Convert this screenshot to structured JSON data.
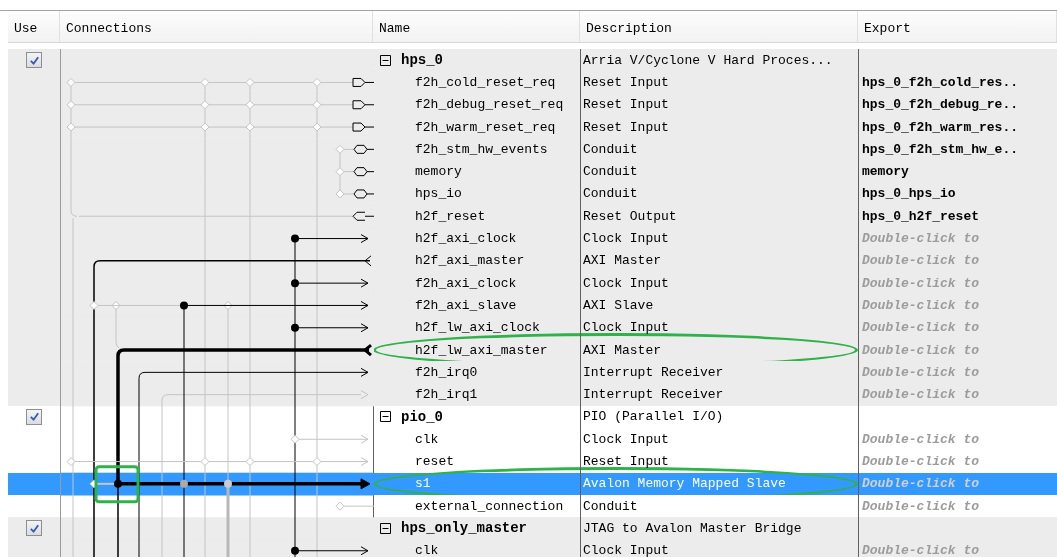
{
  "columns": [
    "Use",
    "Connections",
    "Name",
    "Description",
    "Export"
  ],
  "modules": [
    {
      "name": "hps_0",
      "description": "Arria V/Cyclone V Hard Proces...",
      "use": true,
      "expanded": true,
      "interfaces": [
        {
          "name": "f2h_cold_reset_req",
          "description": "Reset Input",
          "export": {
            "kind": "name",
            "text": "hps_0_f2h_cold_res.."
          },
          "selected": false,
          "circled": false
        },
        {
          "name": "f2h_debug_reset_req",
          "description": "Reset Input",
          "export": {
            "kind": "name",
            "text": "hps_0_f2h_debug_re.."
          },
          "selected": false,
          "circled": false
        },
        {
          "name": "f2h_warm_reset_req",
          "description": "Reset Input",
          "export": {
            "kind": "name",
            "text": "hps_0_f2h_warm_res.."
          },
          "selected": false,
          "circled": false
        },
        {
          "name": "f2h_stm_hw_events",
          "description": "Conduit",
          "export": {
            "kind": "name",
            "text": "hps_0_f2h_stm_hw_e.."
          },
          "selected": false,
          "circled": false
        },
        {
          "name": "memory",
          "description": "Conduit",
          "export": {
            "kind": "name",
            "text": "memory"
          },
          "selected": false,
          "circled": false
        },
        {
          "name": "hps_io",
          "description": "Conduit",
          "export": {
            "kind": "name",
            "text": "hps_0_hps_io"
          },
          "selected": false,
          "circled": false
        },
        {
          "name": "h2f_reset",
          "description": "Reset Output",
          "export": {
            "kind": "name",
            "text": "hps_0_h2f_reset"
          },
          "selected": false,
          "circled": false
        },
        {
          "name": "h2f_axi_clock",
          "description": "Clock Input",
          "export": {
            "kind": "hint",
            "text": "Double-click to"
          },
          "selected": false,
          "circled": false
        },
        {
          "name": "h2f_axi_master",
          "description": "AXI Master",
          "export": {
            "kind": "hint",
            "text": "Double-click to"
          },
          "selected": false,
          "circled": false
        },
        {
          "name": "f2h_axi_clock",
          "description": "Clock Input",
          "export": {
            "kind": "hint",
            "text": "Double-click to"
          },
          "selected": false,
          "circled": false
        },
        {
          "name": "f2h_axi_slave",
          "description": "AXI Slave",
          "export": {
            "kind": "hint",
            "text": "Double-click to"
          },
          "selected": false,
          "circled": false
        },
        {
          "name": "h2f_lw_axi_clock",
          "description": "Clock Input",
          "export": {
            "kind": "hint",
            "text": "Double-click to"
          },
          "selected": false,
          "circled": false
        },
        {
          "name": "h2f_lw_axi_master",
          "description": "AXI Master",
          "export": {
            "kind": "hint",
            "text": "Double-click to"
          },
          "selected": false,
          "circled": true
        },
        {
          "name": "f2h_irq0",
          "description": "Interrupt Receiver",
          "export": {
            "kind": "hint",
            "text": "Double-click to"
          },
          "selected": false,
          "circled": false
        },
        {
          "name": "f2h_irq1",
          "description": "Interrupt Receiver",
          "export": {
            "kind": "hint",
            "text": "Double-click to"
          },
          "selected": false,
          "circled": false
        }
      ]
    },
    {
      "name": "pio_0",
      "description": "PIO (Parallel I/O)",
      "use": true,
      "expanded": true,
      "interfaces": [
        {
          "name": "clk",
          "description": "Clock Input",
          "export": {
            "kind": "hint",
            "text": "Double-click to"
          },
          "selected": false,
          "circled": false
        },
        {
          "name": "reset",
          "description": "Reset Input",
          "export": {
            "kind": "hint",
            "text": "Double-click to"
          },
          "selected": false,
          "circled": false
        },
        {
          "name": "s1",
          "description": "Avalon Memory Mapped Slave",
          "export": {
            "kind": "hint",
            "text": "Double-click to"
          },
          "selected": true,
          "circled": true,
          "connection_marked": true
        },
        {
          "name": "external_connection",
          "description": "Conduit",
          "export": {
            "kind": "hint",
            "text": "Double-click to"
          },
          "selected": false,
          "circled": false
        }
      ]
    },
    {
      "name": "hps_only_master",
      "description": "JTAG to Avalon Master Bridge",
      "use": true,
      "expanded": true,
      "interfaces": [
        {
          "name": "clk",
          "description": "Clock Input",
          "export": {
            "kind": "hint",
            "text": "Double-click to"
          },
          "selected": false,
          "circled": false
        }
      ]
    }
  ]
}
